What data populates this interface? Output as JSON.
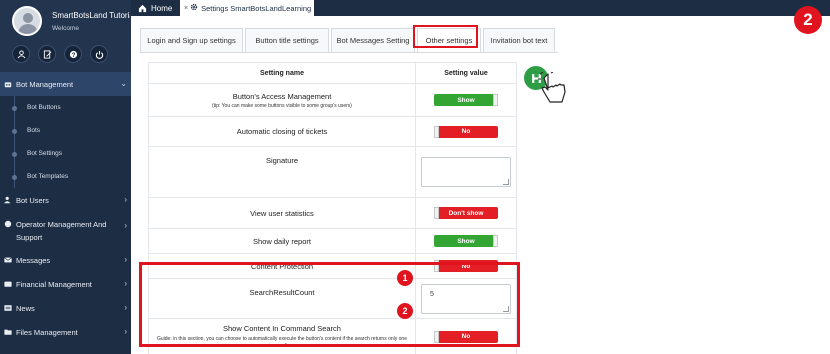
{
  "sidebar": {
    "user_name": "SmartBotsLand Tutorials",
    "welcome": "Welcome",
    "quick_icons": [
      "user-icon",
      "edit-icon",
      "help-icon",
      "power-icon"
    ],
    "menu": {
      "bot_management": "Bot Management",
      "sub_items": [
        "Bot Buttons",
        "Bots",
        "Bot Settings",
        "Bot Templates"
      ],
      "bot_users": "Bot Users",
      "operator_management": "Operator Management And Support",
      "messages": "Messages",
      "financial_management": "Financial Management",
      "news": "News",
      "files_management": "Files Management"
    }
  },
  "topbar": {
    "home": "Home",
    "active_tab": "Settings SmartBotsLandLearning",
    "close": "×"
  },
  "tabs": [
    "Login and Sign up settings",
    "Button title settings",
    "Bot Messages Setting",
    "Other settings",
    "Invitation bot text"
  ],
  "table": {
    "header_name": "Setting name",
    "header_value": "Setting value",
    "rows": [
      {
        "name": "Button's Access Management",
        "note": "(tip: You can make some buttons visible to some group's users)",
        "value": "Show",
        "state": "on"
      },
      {
        "name": "Automatic closing of tickets",
        "value": "No",
        "state": "off"
      },
      {
        "name": "Signature",
        "value": ""
      },
      {
        "name": "View user statistics",
        "value": "Don't show",
        "state": "off"
      },
      {
        "name": "Show daily report",
        "value": "Show",
        "state": "on"
      },
      {
        "name": "Content Protection",
        "value": "No",
        "state": "off"
      },
      {
        "name": "SearchResultCount",
        "value": "5"
      },
      {
        "name": "Show Content In Command Search",
        "note": "Guide: in this section, you can choose to automatically execute the button's content if the search returns only one result.",
        "value": "No",
        "state": "off"
      }
    ]
  },
  "badges": {
    "one": "1",
    "two": "2",
    "step": "2"
  },
  "colors": {
    "sidebar": "#1d2d44",
    "on": "#33a532",
    "off": "#e31e24",
    "highlight": "#e0141e",
    "save": "#2e9e46"
  }
}
